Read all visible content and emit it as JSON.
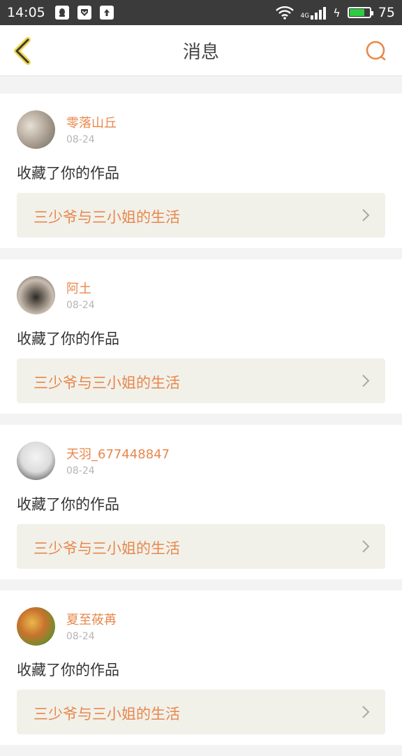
{
  "status_bar": {
    "time": "14:05",
    "battery": "75",
    "battery_level": 0.75,
    "network": "4G"
  },
  "header": {
    "title": "消息",
    "back_icon": "chevron-left-icon",
    "search_icon": "search-icon"
  },
  "colors": {
    "accent": "#e8874b",
    "back": "#e6c23a",
    "card_bg": "#ffffff",
    "work_bg": "#f1f1ea"
  },
  "messages": [
    {
      "user": "零落山丘",
      "date": "08-24",
      "action": "收藏了你的作品",
      "work": "三少爷与三小姐的生活"
    },
    {
      "user": "阿土",
      "date": "08-24",
      "action": "收藏了你的作品",
      "work": "三少爷与三小姐的生活"
    },
    {
      "user": "天羽_677448847",
      "date": "08-24",
      "action": "收藏了你的作品",
      "work": "三少爷与三小姐的生活"
    },
    {
      "user": "夏至莜苒",
      "date": "08-24",
      "action": "收藏了你的作品",
      "work": "三少爷与三小姐的生活"
    }
  ]
}
